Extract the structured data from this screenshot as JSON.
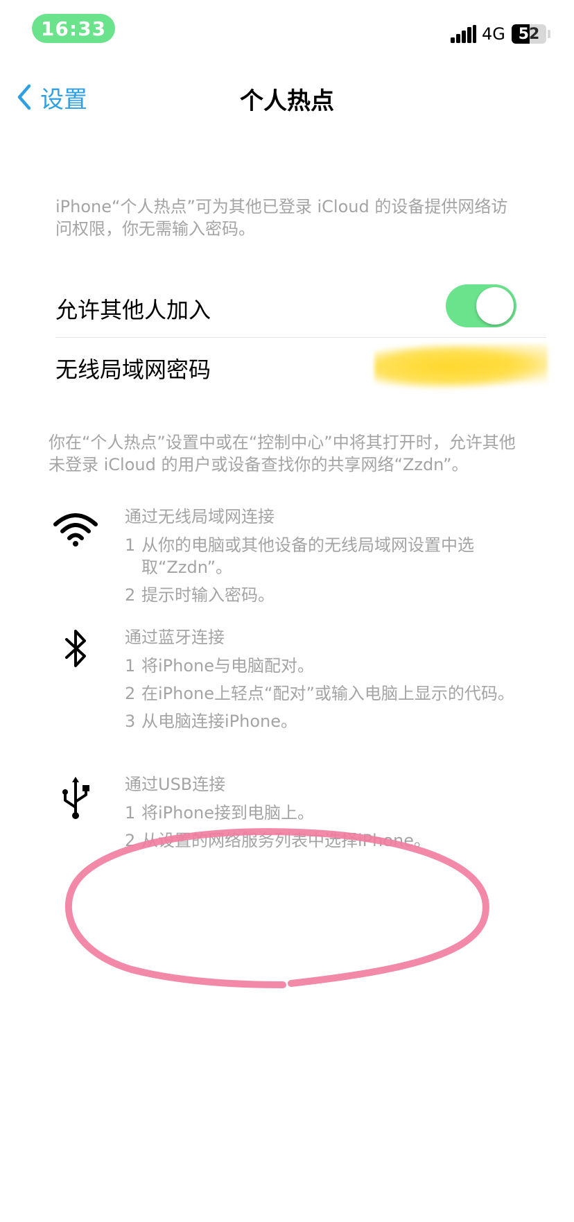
{
  "status_bar": {
    "time": "16:33",
    "network": "4G",
    "battery": "52",
    "battery_level": 0.52
  },
  "nav": {
    "back_label": "设置",
    "title": "个人热点"
  },
  "intro": "iPhone“个人热点”可为其他已登录 iCloud 的设备提供网络访问权限，你无需输入密码。",
  "settings": {
    "allow_others_label": "允许其他人加入",
    "allow_others_on": true,
    "wifi_password_label": "无线局域网密码"
  },
  "share_note": "你在“个人热点”设置中或在“控制中心”中将其打开时，允许其他未登录 iCloud 的用户或设备查找你的共享网络“Zzdn”。",
  "methods": [
    {
      "icon": "wifi-icon",
      "title": "通过无线局域网连接",
      "steps": [
        {
          "num": "1",
          "text": "从你的电脑或其他设备的无线局域网设置中选取“Zzdn”。"
        },
        {
          "num": "2",
          "text": "提示时输入密码。"
        }
      ]
    },
    {
      "icon": "bluetooth-icon",
      "title": "通过蓝牙连接",
      "steps": [
        {
          "num": "1",
          "text": "将iPhone与电脑配对。"
        },
        {
          "num": "2",
          "text": "在iPhone上轻点“配对”或输入电脑上显示的代码。"
        },
        {
          "num": "3",
          "text": "从电脑连接iPhone。"
        }
      ]
    },
    {
      "icon": "usb-icon",
      "title": "通过USB连接",
      "steps": [
        {
          "num": "1",
          "text": "将iPhone接到电脑上。"
        },
        {
          "num": "2",
          "text": "从设置的网络服务列表中选择iPhone。"
        }
      ]
    }
  ],
  "colors": {
    "accent": "#2f9fe0",
    "toggle_on": "#6be28c",
    "secondary_text": "#a4a4a4",
    "annotation": "#f17ca0",
    "redaction": "#ffd633"
  }
}
